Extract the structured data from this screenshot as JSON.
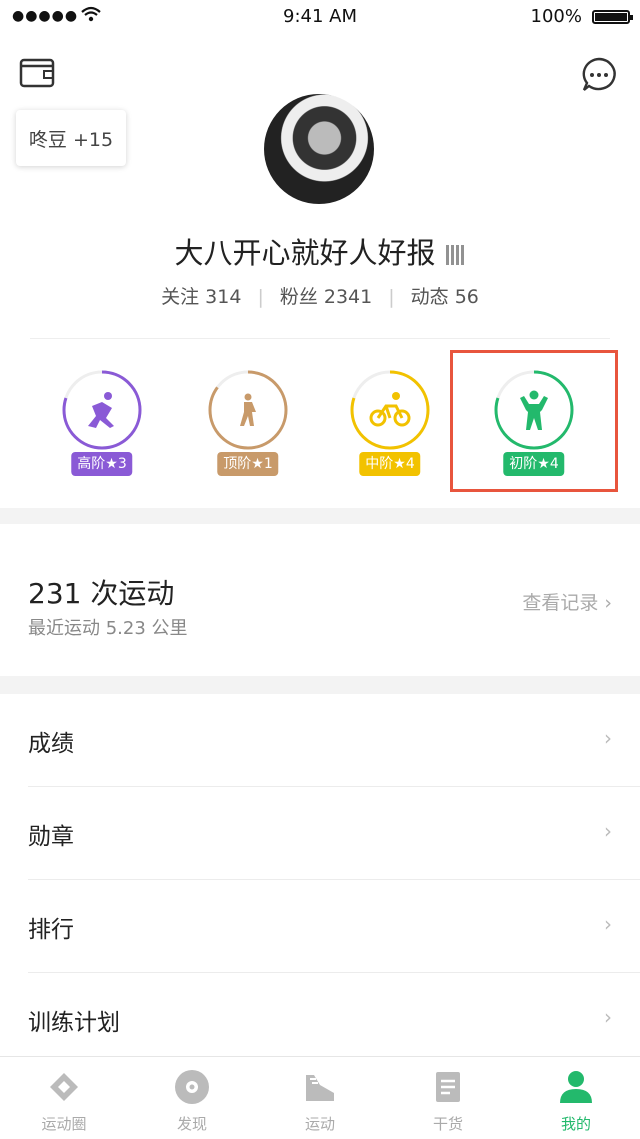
{
  "status_bar": {
    "signal": "●●●●●",
    "time": "9:41 AM",
    "battery": "100%"
  },
  "tooltip": {
    "text": "咚豆 +15"
  },
  "profile": {
    "name": "大八开心就好人好报",
    "stats": [
      {
        "label": "关注 314"
      },
      {
        "label": "粉丝 2341"
      },
      {
        "label": "动态 56"
      }
    ]
  },
  "levels": [
    {
      "name": "running",
      "badge": "高阶★3",
      "color": "#8a5ad6",
      "progress": 0.8
    },
    {
      "name": "walking",
      "badge": "顶阶★1",
      "color": "#c89a6a",
      "progress": 0.85
    },
    {
      "name": "cycling",
      "badge": "中阶★4",
      "color": "#f2c200",
      "progress": 0.8
    },
    {
      "name": "training",
      "badge": "初阶★4",
      "color": "#23b96c",
      "progress": 0.8
    }
  ],
  "summary": {
    "count": "231 次运动",
    "recent": "最近运动 5.23 公里",
    "record": "查看记录 ›"
  },
  "menu": [
    {
      "label": "成绩"
    },
    {
      "label": "勋章"
    },
    {
      "label": "排行"
    },
    {
      "label": "训练计划"
    }
  ],
  "tabs": [
    {
      "label": "运动圈"
    },
    {
      "label": "发现"
    },
    {
      "label": "运动"
    },
    {
      "label": "干货"
    },
    {
      "label": "我的"
    }
  ],
  "colors": {
    "accent": "#23b96c",
    "highlight": "#e8553d"
  }
}
